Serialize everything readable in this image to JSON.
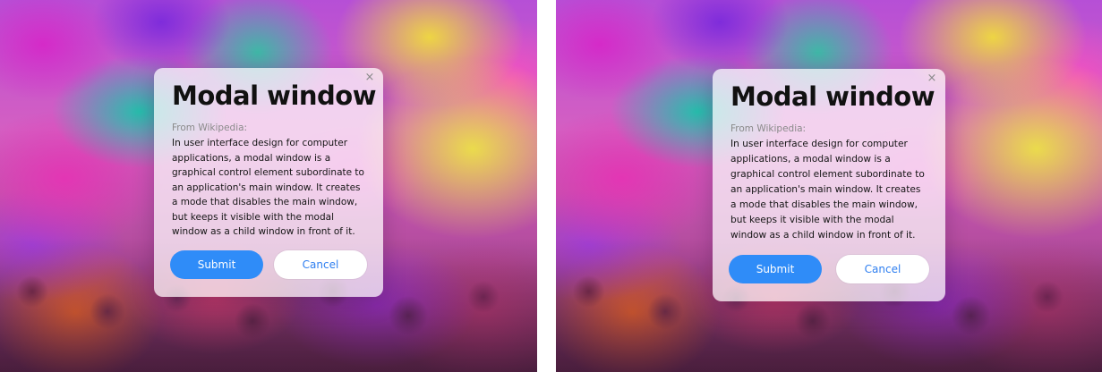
{
  "variants": [
    {
      "modal": {
        "title": "Modal window",
        "close_glyph": "×",
        "source": "From Wikipedia:",
        "body": "In user interface design for computer applications, a modal window is a graphical control element subordinate to an application's main window. It creates a mode that disables the main window, but keeps it visible with the modal window as a child window in front of it.",
        "submit_label": "Submit",
        "cancel_label": "Cancel"
      }
    },
    {
      "modal": {
        "title": "Modal window",
        "close_glyph": "×",
        "source": "From Wikipedia:",
        "body": "In user interface design for computer applications, a modal window is a graphical control element subordinate to an application's main window. It creates a mode that disables the main window, but keeps it visible with the modal window as a child window in front of it.",
        "submit_label": "Submit",
        "cancel_label": "Cancel"
      }
    }
  ],
  "colors": {
    "primary_button": "#2f8cf8",
    "cancel_text": "#2f7ff0",
    "title_text": "#111111",
    "source_text": "#8a8a8a"
  }
}
